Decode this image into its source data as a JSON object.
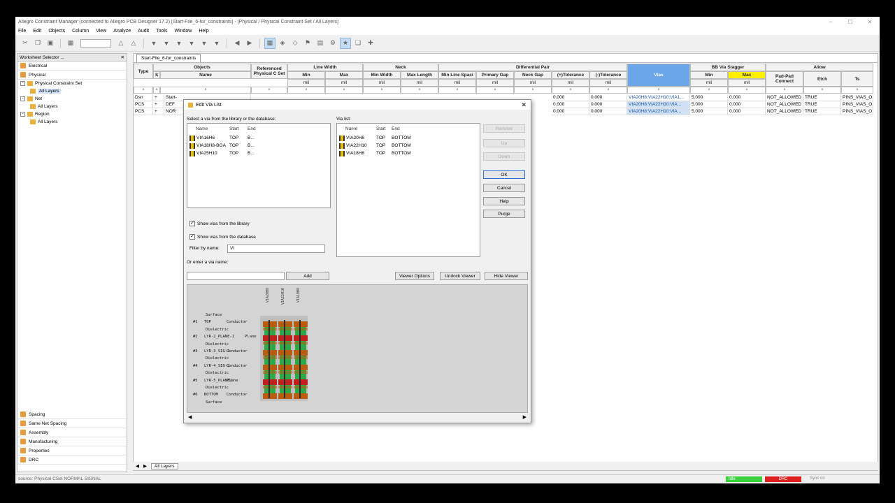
{
  "window": {
    "title": "Allegro Constraint Manager (connected to Allegro PCB Designer 17.2) [Start-File_6-for_constraints] - [Physical / Physical Constraint Set / All Layers]"
  },
  "menu": [
    "File",
    "Edit",
    "Objects",
    "Column",
    "View",
    "Analyze",
    "Audit",
    "Tools",
    "Window",
    "Help"
  ],
  "sidebar": {
    "header": "Worksheet Selector ...",
    "top_categories": [
      "Electrical",
      "Physical"
    ],
    "tree": [
      {
        "label": "Physical Constraint Set",
        "level": 0,
        "expanded": true
      },
      {
        "label": "All Layers",
        "level": 1,
        "selected": true
      },
      {
        "label": "Net",
        "level": 0,
        "expanded": true
      },
      {
        "label": "All Layers",
        "level": 1
      },
      {
        "label": "Region",
        "level": 0,
        "expanded": true
      },
      {
        "label": "All Layers",
        "level": 1
      }
    ],
    "bottom_categories": [
      "Spacing",
      "Same Net Spacing",
      "Assembly",
      "Manufacturing",
      "Properties",
      "DRC"
    ]
  },
  "worksheet": {
    "tab": "Start-File_6-for_constraints",
    "headers": {
      "objects": "Objects",
      "type": "Type",
      "s": "S",
      "name": "Name",
      "ref_cset": "Referenced Physical C Set",
      "line_width": "Line Width",
      "neck": "Neck",
      "diff_pair": "Differential Pair",
      "vias": "Vias",
      "bb_via_stagger": "BB Via Stagger",
      "allow": "Allow",
      "min": "Min",
      "max": "Max",
      "min_width": "Min Width",
      "max_length": "Max Length",
      "min_line_spacing": "Min Line Spaci",
      "primary_gap": "Primary Gap",
      "neck_gap": "Neck Gap",
      "plus_tol": "(+)Tolerance",
      "minus_tol": "(-)Tolerance",
      "pad_pad": "Pad-Pad Connect",
      "etch": "Etch",
      "ts": "Ts",
      "unit": "mil",
      "star": "*"
    },
    "rows": [
      {
        "type": "Dsn",
        "name": "Start-",
        "plus": "0.000",
        "minus": "0.000",
        "vias": "VIA20H8:VIA22H10:VIA1...",
        "bbmin": "5.000",
        "bbmax": "0.000",
        "pad": "NOT_ALLOWED",
        "etch": "TRUE",
        "ts": "PINS_VIAS_O..."
      },
      {
        "type": "PCS",
        "name": "DEF",
        "plus": "0.000",
        "minus": "0.000",
        "vias": "VIA20H8:VIA22H10:VIA...",
        "bbmin": "5.000",
        "bbmax": "0.000",
        "pad": "NOT_ALLOWED",
        "etch": "TRUE",
        "ts": "PINS_VIAS_O..."
      },
      {
        "type": "PCS",
        "name": "NOR",
        "plus": "0.000",
        "minus": "0.000",
        "vias": "VIA20H8:VIA22H10:VIA...",
        "bbmin": "5.000",
        "bbmax": "0.000",
        "pad": "NOT_ALLOWED",
        "etch": "TRUE",
        "ts": "PINS_VIAS_O..."
      }
    ],
    "bottom_tab": "All Layers"
  },
  "dialog": {
    "title": "Edit Via List",
    "select_label": "Select a via from the library or the database:",
    "via_list_label": "Via list:",
    "col_name": "Name",
    "col_start": "Start",
    "col_end": "End",
    "library_vias": [
      {
        "name": "VIA16H6",
        "start": "TOP",
        "end": "B..."
      },
      {
        "name": "VIA18H8-BGA",
        "start": "TOP",
        "end": "B..."
      },
      {
        "name": "VIA25H10",
        "start": "TOP",
        "end": "B..."
      }
    ],
    "selected_vias": [
      {
        "name": "VIA20H8",
        "start": "TOP",
        "end": "BOTTOM"
      },
      {
        "name": "VIA22H10",
        "start": "TOP",
        "end": "BOTTOM"
      },
      {
        "name": "VIA18H8",
        "start": "TOP",
        "end": "BOTTOM"
      }
    ],
    "buttons": {
      "remove": "Remove",
      "up": "Up",
      "down": "Down",
      "ok": "OK",
      "cancel": "Cancel",
      "help": "Help",
      "purge": "Purge",
      "add": "Add",
      "viewer_options": "Viewer Options",
      "undock_viewer": "Undock Viewer",
      "hide_viewer": "Hide Viewer"
    },
    "show_library": "Show vias from the library",
    "show_database": "Show vias from the database",
    "filter_label": "Filter by name:",
    "filter_value": "VI",
    "enter_label": "Or enter a via name:",
    "via_name_value": "",
    "viewer": {
      "columns": [
        "VIA20H8",
        "VIA22H10",
        "VIA18H8"
      ],
      "stack": [
        {
          "num": "",
          "name": "Surface",
          "kind": ""
        },
        {
          "num": "#1",
          "name": "TOP",
          "kind": "Conductor"
        },
        {
          "num": "",
          "name": "Dielectric",
          "kind": ""
        },
        {
          "num": "#2",
          "name": "LYR-2_PLANE-1",
          "kind": "Plane"
        },
        {
          "num": "",
          "name": "Dielectric",
          "kind": ""
        },
        {
          "num": "#3",
          "name": "LYR-3_SIG-1",
          "kind": "Conductor"
        },
        {
          "num": "",
          "name": "Dielectric",
          "kind": ""
        },
        {
          "num": "#4",
          "name": "LYR-4_SIG-2",
          "kind": "Conductor"
        },
        {
          "num": "",
          "name": "Dielectric",
          "kind": ""
        },
        {
          "num": "#5",
          "name": "LYR-5_PLANE2",
          "kind": "Plane"
        },
        {
          "num": "",
          "name": "Dielectric",
          "kind": ""
        },
        {
          "num": "#6",
          "name": "BOTTOM",
          "kind": "Conductor"
        },
        {
          "num": "",
          "name": "Surface",
          "kind": ""
        }
      ]
    }
  },
  "status": {
    "text": "source: Physical CSet NORMAL SIGNAL",
    "idle": "Idle",
    "drc": "DRC",
    "sync": "Sync on"
  },
  "colors": {
    "vias_header": "#6aa6e8",
    "max_header": "#fff000",
    "idle": "#3ad23a",
    "drc": "#e02020",
    "via_pad": "#b85c10",
    "via_fill": "#2fa84a",
    "via_plane": "#c02020"
  }
}
